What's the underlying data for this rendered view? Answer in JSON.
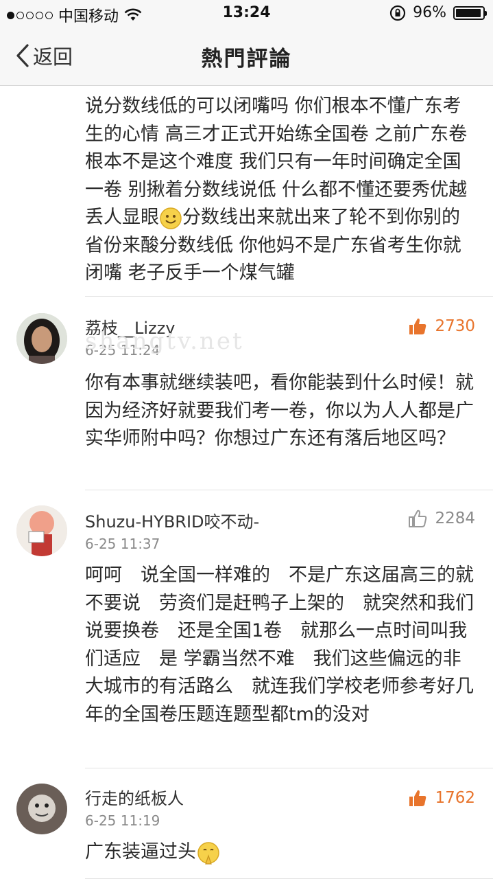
{
  "status_bar": {
    "carrier": "中国移动",
    "time": "13:24",
    "battery": "96%",
    "battery_level": 0.96
  },
  "nav": {
    "back_label": "返回",
    "title": "熱門評論"
  },
  "watermark": "shangtv.net",
  "comments": [
    {
      "text": "说分数线低的可以闭嘴吗 你们根本不懂广东考生的心情 高三才正式开始练全国卷 之前广东卷根本不是这个难度 我们只有一年时间确定全国一卷 别揪着分数线说低 什么都不懂还要秀优越 丢人显眼",
      "text_after_emoji": "分数线出来就出来了轮不到你别的省份来酸分数线低 你他妈不是广东省考生你就闭嘴 老子反手一个煤气罐"
    },
    {
      "name": "荔枝__Lizzy",
      "time": "6-25 11:24",
      "likes": "2730",
      "text": "你有本事就继续装吧，看你能装到什么时候！就因为经济好就要我们考一卷，你以为人人都是广实华师附中吗？你想过广东还有落后地区吗？"
    },
    {
      "name": "Shuzu-HYBRID咬不动-",
      "time": "6-25 11:37",
      "likes": "2284",
      "text": "呵呵　说全国一样难的　不是广东这届高三的就不要说　劳资们是赶鸭子上架的　就突然和我们说要换卷　还是全国1卷　就那么一点时间叫我们适应　是 学霸当然不难　我们这些偏远的非大城市的有活路么　就连我们学校老师参考好几年的全国卷压题连题型都tm的没对"
    },
    {
      "name": "行走的纸板人",
      "time": "6-25 11:19",
      "likes": "1762",
      "text": "广东装逼过头"
    }
  ]
}
